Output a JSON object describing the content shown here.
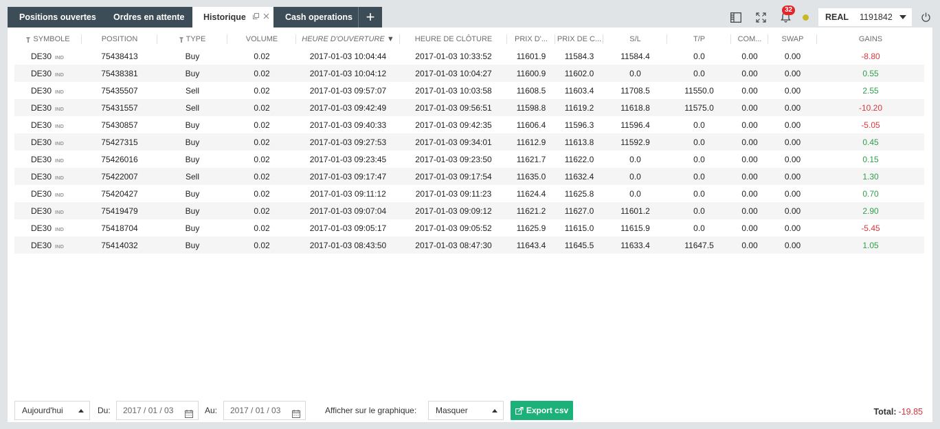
{
  "tabs": [
    {
      "label": "Positions ouvertes"
    },
    {
      "label": "Ordres en attente"
    },
    {
      "label": "Historique"
    },
    {
      "label": "Cash operations"
    }
  ],
  "add_tab": "+",
  "notifications": {
    "count": "32"
  },
  "status_color": "#c9b825",
  "account": {
    "type": "REAL",
    "number": "1191842"
  },
  "columns": [
    "SYMBOLE",
    "POSITION",
    "TYPE",
    "VOLUME",
    "HEURE D'OUVERTURE",
    "HEURE DE CLÔTURE",
    "PRIX D'...",
    "PRIX DE C...",
    "S/L",
    "T/P",
    "COM...",
    "SWAP",
    "GAINS"
  ],
  "sort_indicator": "▼",
  "rows": [
    {
      "symbol": "DE30",
      "cls": "IND",
      "position": "75438413",
      "type": "Buy",
      "volume": "0.02",
      "open": "2017-01-03 10:04:44",
      "close": "2017-01-03 10:33:52",
      "open_price": "11601.9",
      "close_price": "11584.3",
      "sl": "11584.4",
      "tp": "0.0",
      "com": "0.00",
      "swap": "0.00",
      "gain": "-8.80"
    },
    {
      "symbol": "DE30",
      "cls": "IND",
      "position": "75438381",
      "type": "Buy",
      "volume": "0.02",
      "open": "2017-01-03 10:04:12",
      "close": "2017-01-03 10:04:27",
      "open_price": "11600.9",
      "close_price": "11602.0",
      "sl": "0.0",
      "tp": "0.0",
      "com": "0.00",
      "swap": "0.00",
      "gain": "0.55"
    },
    {
      "symbol": "DE30",
      "cls": "IND",
      "position": "75435507",
      "type": "Sell",
      "volume": "0.02",
      "open": "2017-01-03 09:57:07",
      "close": "2017-01-03 10:03:58",
      "open_price": "11608.5",
      "close_price": "11603.4",
      "sl": "11708.5",
      "tp": "11550.0",
      "com": "0.00",
      "swap": "0.00",
      "gain": "2.55"
    },
    {
      "symbol": "DE30",
      "cls": "IND",
      "position": "75431557",
      "type": "Sell",
      "volume": "0.02",
      "open": "2017-01-03 09:42:49",
      "close": "2017-01-03 09:56:51",
      "open_price": "11598.8",
      "close_price": "11619.2",
      "sl": "11618.8",
      "tp": "11575.0",
      "com": "0.00",
      "swap": "0.00",
      "gain": "-10.20"
    },
    {
      "symbol": "DE30",
      "cls": "IND",
      "position": "75430857",
      "type": "Buy",
      "volume": "0.02",
      "open": "2017-01-03 09:40:33",
      "close": "2017-01-03 09:42:35",
      "open_price": "11606.4",
      "close_price": "11596.3",
      "sl": "11596.4",
      "tp": "0.0",
      "com": "0.00",
      "swap": "0.00",
      "gain": "-5.05"
    },
    {
      "symbol": "DE30",
      "cls": "IND",
      "position": "75427315",
      "type": "Buy",
      "volume": "0.02",
      "open": "2017-01-03 09:27:53",
      "close": "2017-01-03 09:34:01",
      "open_price": "11612.9",
      "close_price": "11613.8",
      "sl": "11592.9",
      "tp": "0.0",
      "com": "0.00",
      "swap": "0.00",
      "gain": "0.45"
    },
    {
      "symbol": "DE30",
      "cls": "IND",
      "position": "75426016",
      "type": "Buy",
      "volume": "0.02",
      "open": "2017-01-03 09:23:45",
      "close": "2017-01-03 09:23:50",
      "open_price": "11621.7",
      "close_price": "11622.0",
      "sl": "0.0",
      "tp": "0.0",
      "com": "0.00",
      "swap": "0.00",
      "gain": "0.15"
    },
    {
      "symbol": "DE30",
      "cls": "IND",
      "position": "75422007",
      "type": "Sell",
      "volume": "0.02",
      "open": "2017-01-03 09:17:47",
      "close": "2017-01-03 09:17:54",
      "open_price": "11635.0",
      "close_price": "11632.4",
      "sl": "0.0",
      "tp": "0.0",
      "com": "0.00",
      "swap": "0.00",
      "gain": "1.30"
    },
    {
      "symbol": "DE30",
      "cls": "IND",
      "position": "75420427",
      "type": "Buy",
      "volume": "0.02",
      "open": "2017-01-03 09:11:12",
      "close": "2017-01-03 09:11:23",
      "open_price": "11624.4",
      "close_price": "11625.8",
      "sl": "0.0",
      "tp": "0.0",
      "com": "0.00",
      "swap": "0.00",
      "gain": "0.70"
    },
    {
      "symbol": "DE30",
      "cls": "IND",
      "position": "75419479",
      "type": "Buy",
      "volume": "0.02",
      "open": "2017-01-03 09:07:04",
      "close": "2017-01-03 09:09:12",
      "open_price": "11621.2",
      "close_price": "11627.0",
      "sl": "11601.2",
      "tp": "0.0",
      "com": "0.00",
      "swap": "0.00",
      "gain": "2.90"
    },
    {
      "symbol": "DE30",
      "cls": "IND",
      "position": "75418704",
      "type": "Buy",
      "volume": "0.02",
      "open": "2017-01-03 09:05:17",
      "close": "2017-01-03 09:05:52",
      "open_price": "11625.9",
      "close_price": "11615.0",
      "sl": "11615.9",
      "tp": "0.0",
      "com": "0.00",
      "swap": "0.00",
      "gain": "-5.45"
    },
    {
      "symbol": "DE30",
      "cls": "IND",
      "position": "75414032",
      "type": "Buy",
      "volume": "0.02",
      "open": "2017-01-03 08:43:50",
      "close": "2017-01-03 08:47:30",
      "open_price": "11643.4",
      "close_price": "11645.5",
      "sl": "11633.4",
      "tp": "11647.5",
      "com": "0.00",
      "swap": "0.00",
      "gain": "1.05"
    }
  ],
  "colors": {
    "negative": "#d9363e",
    "positive": "#2f9e4a",
    "export_button": "#1db17a",
    "tab_bar": "#3d4d58"
  },
  "footer": {
    "period": "Aujourd'hui",
    "from_label": "Du:",
    "from_date": "2017 / 01 / 03",
    "to_label": "Au:",
    "to_date": "2017 / 01 / 03",
    "chart_label": "Afficher sur le graphique:",
    "chart_value": "Masquer",
    "export_label": "Export csv",
    "total_label": "Total:",
    "total_value": "-19.85"
  },
  "icons": [
    "layout-icon",
    "fullscreen-icon",
    "bell-icon",
    "status-dot-icon",
    "power-icon",
    "popout-icon",
    "close-icon",
    "calendar-icon",
    "export-icon",
    "filter-icon",
    "chevron-down-icon"
  ]
}
